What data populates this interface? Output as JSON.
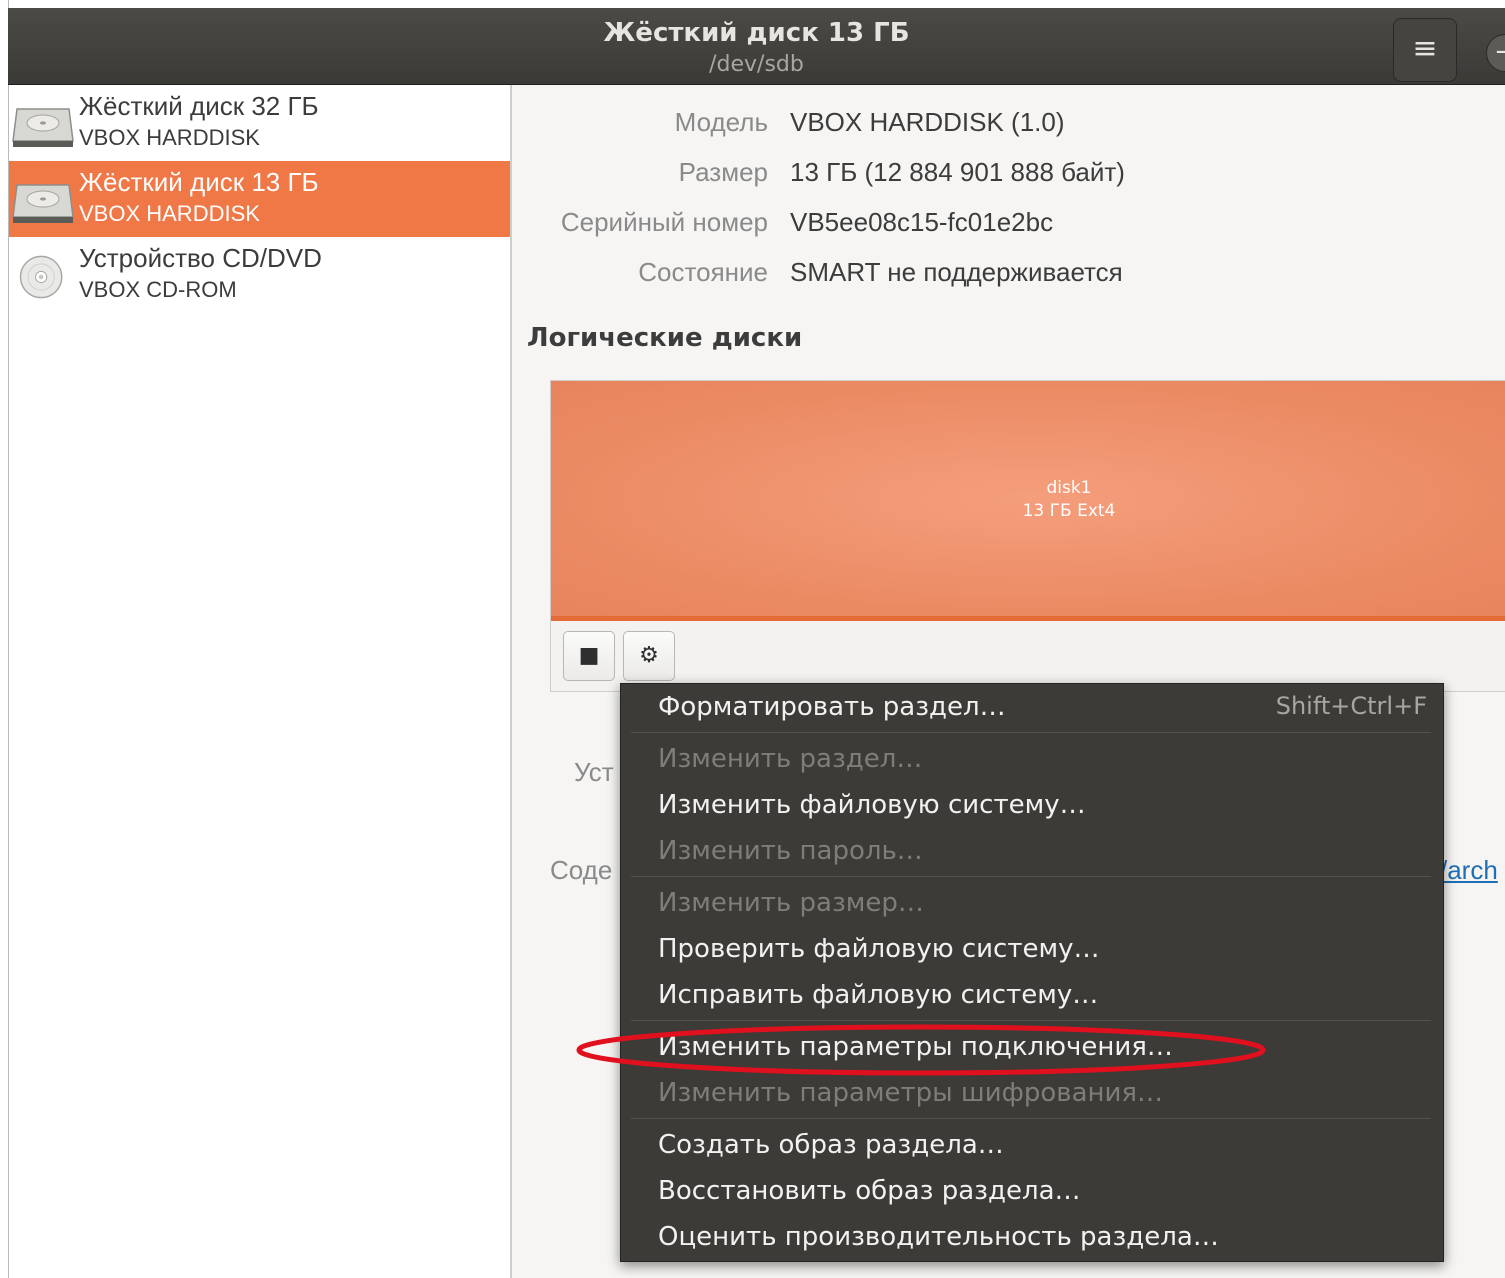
{
  "header": {
    "title": "Жёсткий диск 13 ГБ",
    "subtitle": "/dev/sdb",
    "menu_icon": "≡",
    "close_icon": "−"
  },
  "sidebar": {
    "items": [
      {
        "name": "Жёсткий диск 32 ГБ",
        "model": "VBOX HARDDISK",
        "icon": "hard-disk-icon",
        "selected": false
      },
      {
        "name": "Жёсткий диск 13 ГБ",
        "model": "VBOX HARDDISK",
        "icon": "hard-disk-icon",
        "selected": true
      },
      {
        "name": "Устройство CD/DVD",
        "model": "VBOX CD-ROM",
        "icon": "optical-disc-icon",
        "selected": false
      }
    ],
    "selected_color": "#f07746"
  },
  "info": {
    "model_label": "Модель",
    "model_value": "VBOX HARDDISK (1.0)",
    "size_label": "Размер",
    "size_value": "13 ГБ (12 884 901 888 байт)",
    "serial_label": "Серийный номер",
    "serial_value": "VB5ee08c15-fc01e2bc",
    "state_label": "Состояние",
    "state_value": "SMART не поддерживается"
  },
  "volumes": {
    "title": "Логические диски",
    "partition_name": "disk1",
    "partition_size": "13 ГБ Ext4",
    "stop_icon": "■",
    "gear_icon": "⚙",
    "behind_label_1": "Уст",
    "behind_label_2": "Соде",
    "behind_link": "/arch"
  },
  "context_menu": {
    "items": [
      {
        "label": "Форматировать раздел…",
        "accel": "Shift+Ctrl+F",
        "disabled": false
      },
      {
        "label": "Изменить раздел…",
        "disabled": true
      },
      {
        "label": "Изменить файловую систему…",
        "disabled": false
      },
      {
        "label": "Изменить пароль…",
        "disabled": true
      },
      {
        "label": "Изменить размер…",
        "disabled": true
      },
      {
        "label": "Проверить файловую систему…",
        "disabled": false
      },
      {
        "label": "Исправить файловую систему…",
        "disabled": false
      },
      {
        "label": "Изменить параметры подключения…",
        "disabled": false,
        "highlighted": true
      },
      {
        "label": "Изменить параметры шифрования…",
        "disabled": true
      },
      {
        "label": "Создать образ раздела…",
        "disabled": false
      },
      {
        "label": "Восстановить образ раздела…",
        "disabled": false
      },
      {
        "label": "Оценить производительность раздела…",
        "disabled": false
      }
    ],
    "highlight_color": "#e0101e"
  }
}
